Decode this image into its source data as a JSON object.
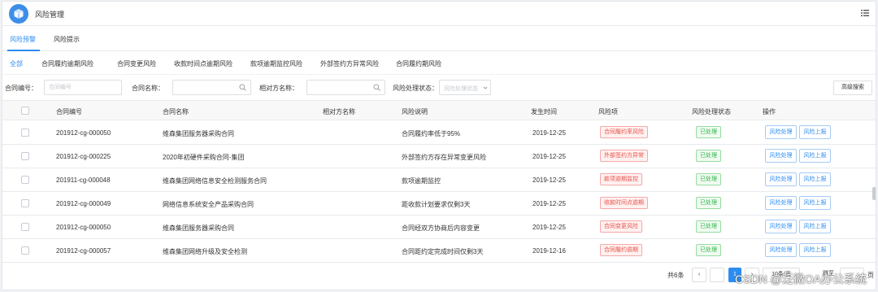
{
  "app": {
    "title": "风险管理"
  },
  "tabs": [
    {
      "label": "风险预警"
    },
    {
      "label": "风险提示"
    }
  ],
  "subtabs": [
    {
      "label": "全部"
    },
    {
      "label": "合同履约逾期风险"
    },
    {
      "label": "合同变更风险"
    },
    {
      "label": "收款时间点逾期风险"
    },
    {
      "label": "款项逾期监控风险"
    },
    {
      "label": "外部签约方异常风险"
    },
    {
      "label": "合同履约期风险"
    }
  ],
  "filters": {
    "contract_no_label": "合同编号：",
    "contract_no_placeholder": "合同编号",
    "contract_name_label": "合同名称：",
    "counterparty_label": "相对方名称：",
    "status_label": "风险处理状态：",
    "status_placeholder": "风险处理状态",
    "advanced_search": "高级搜索"
  },
  "table": {
    "headers": {
      "contract_no": "合同编号",
      "contract_name": "合同名称",
      "counterparty": "相对方名称",
      "risk_desc": "风险说明",
      "occurred": "发生时间",
      "risk_item": "风险项",
      "status": "风险处理状态",
      "actions": "操作"
    },
    "rows": [
      {
        "no": "201912-cg-000050",
        "name": "维森集团服务器采购合同",
        "desc": "合同履约率低于95%",
        "date": "2019-12-25",
        "risk": "合同履约率风险",
        "status": "已处理",
        "btn1": "风险处理",
        "btn2": "风险上报"
      },
      {
        "no": "201912-cg-000225",
        "name": "2020年初硬件采购合同-集团",
        "desc": "外部签约方存在异常变更风险",
        "date": "2019-12-25",
        "risk": "外部签约方异常",
        "status": "已处理",
        "btn1": "风险处理",
        "btn2": "风险上报"
      },
      {
        "no": "201911-cg-000048",
        "name": "维森集团网络信息安全检测服务合同",
        "desc": "款项逾期监控",
        "date": "2019-12-25",
        "risk": "款项逾期监控",
        "status": "已处理",
        "btn1": "风险处理",
        "btn2": "风险上报"
      },
      {
        "no": "201912-cg-000049",
        "name": "网络信息系统安全产品采购合同",
        "desc": "距收款计划要求仅剩3天",
        "date": "2019-12-25",
        "risk": "收款时间点逾期",
        "status": "已处理",
        "btn1": "风险处理",
        "btn2": "风险上报"
      },
      {
        "no": "201912-cg-000050",
        "name": "维森集团服务器采购合同",
        "desc": "合同经双方协商后内容变更",
        "date": "2019-12-25",
        "risk": "合同变更风险",
        "status": "已处理",
        "btn1": "风险处理",
        "btn2": "风险上报"
      },
      {
        "no": "201912-cg-000057",
        "name": "维森集团网络升级及安全检测",
        "desc": "合同距约定完成时间仅剩3天",
        "date": "2019-12-16",
        "risk": "合同履约逾期",
        "status": "已处理",
        "btn1": "风险处理",
        "btn2": "风险上报"
      }
    ]
  },
  "pagination": {
    "total": "共6条",
    "current": "1",
    "page_size": "10条/页",
    "goto": "跳至",
    "suffix": "页"
  },
  "watermark": "CSDN @泛微OA办公系统",
  "colors": {
    "accent": "#2d8cf0",
    "danger": "#e8524a",
    "success": "#2fb64a"
  }
}
